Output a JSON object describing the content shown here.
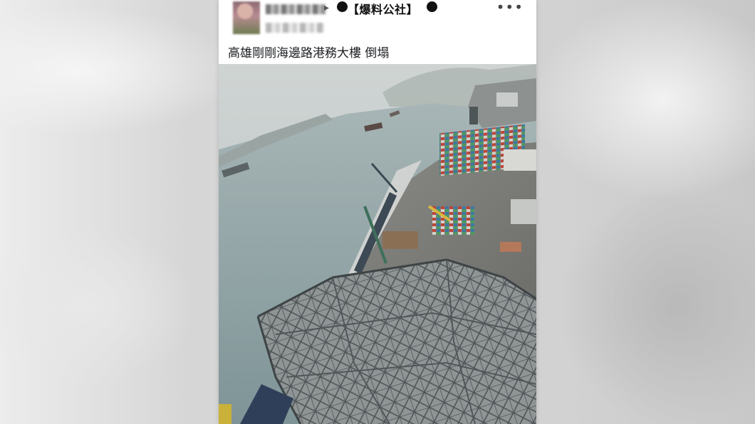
{
  "post": {
    "page_name": "【爆料公社】",
    "text": "高雄剛剛海邊路港務大樓 倒塌",
    "more_icon": "ellipsis-icon",
    "share_arrow_icon": "triangle-arrow-icon"
  },
  "photo": {
    "subject": "collapsed-steel-frame-harbor-building"
  },
  "colors": {
    "post_bg": "#ffffff",
    "water": "#8fa3a6",
    "sky": "#c9cfcf"
  }
}
